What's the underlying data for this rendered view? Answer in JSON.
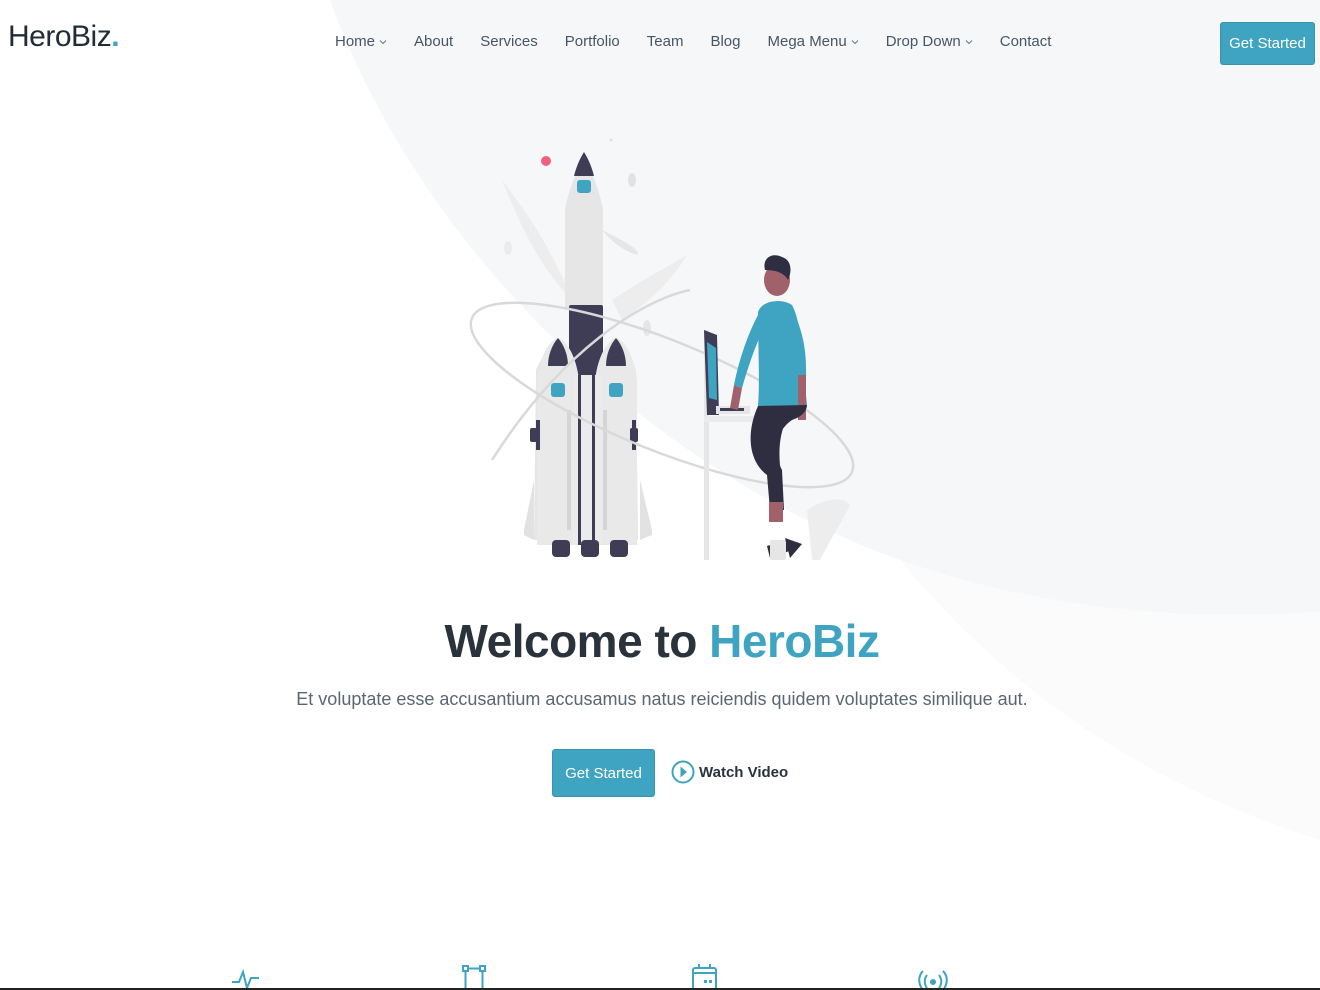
{
  "brand": {
    "name": "HeroBiz",
    "dot": ".",
    "accent_color": "#3fa4c1"
  },
  "nav": {
    "items": [
      {
        "label": "Home",
        "dropdown": true
      },
      {
        "label": "About",
        "dropdown": false
      },
      {
        "label": "Services",
        "dropdown": false
      },
      {
        "label": "Portfolio",
        "dropdown": false
      },
      {
        "label": "Team",
        "dropdown": false
      },
      {
        "label": "Blog",
        "dropdown": false
      },
      {
        "label": "Mega Menu",
        "dropdown": true
      },
      {
        "label": "Drop Down",
        "dropdown": true
      },
      {
        "label": "Contact",
        "dropdown": false
      }
    ],
    "cta_label": "Get Started"
  },
  "hero": {
    "title_prefix": "Welcome to ",
    "title_accent": "HeroBiz",
    "subtitle": "Et voluptate esse accusantium accusamus natus reiciendis quidem voluptates similique aut.",
    "primary_button": "Get Started",
    "video_link": "Watch Video",
    "illustration": "rocket-launch-person-at-laptop"
  },
  "features": {
    "icons": [
      "activity-icon",
      "bounding-box-icon",
      "calendar-icon",
      "broadcast-icon"
    ]
  }
}
